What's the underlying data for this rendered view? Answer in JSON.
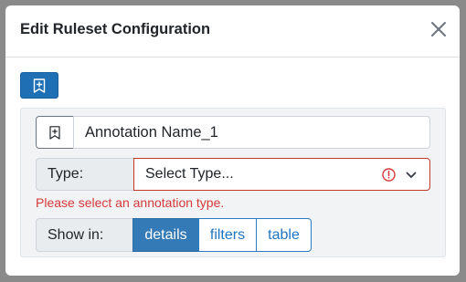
{
  "modal": {
    "title": "Edit Ruleset Configuration"
  },
  "toolbar": {
    "add_icon": "bookmark-plus-icon"
  },
  "annotation": {
    "name_icon": "bookmark-icon",
    "name_value": "Annotation Name_1",
    "type_label": "Type:",
    "type_value": "Select Type...",
    "type_error_icon": "exclamation-circle-icon",
    "type_dropdown_icon": "chevron-down-icon",
    "error_message": "Please select an annotation type.",
    "show_in_label": "Show in:",
    "show_in_options": [
      {
        "label": "details",
        "active": true
      },
      {
        "label": "filters",
        "active": false
      },
      {
        "label": "table",
        "active": false
      }
    ]
  },
  "colors": {
    "primary": "#337ab7",
    "error": "#d63a3a",
    "link": "#1f74c2"
  }
}
